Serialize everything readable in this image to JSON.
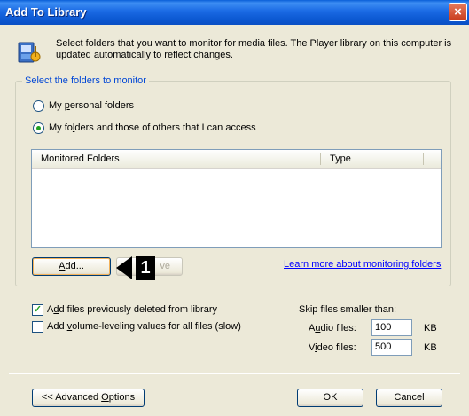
{
  "window": {
    "title": "Add To Library",
    "close_icon": "×"
  },
  "header": {
    "icon": "media-library-icon",
    "description": "Select folders that you want to monitor for media files. The Player library on this computer is updated automatically to reflect changes."
  },
  "group": {
    "label": "Select the folders to monitor",
    "options": [
      {
        "pre": "My ",
        "accel": "p",
        "post": "ersonal folders",
        "checked": false
      },
      {
        "pre": "My fo",
        "accel": "l",
        "post": "ders and those of others that I can access",
        "checked": true
      }
    ]
  },
  "list": {
    "columns": [
      "Monitored Folders",
      "Type"
    ],
    "rows": []
  },
  "buttons": {
    "add_accel": "A",
    "add_rest": "dd...",
    "remove_visible": "ve",
    "ok": "OK",
    "cancel": "Cancel",
    "advanced_pre": "<< Advanced ",
    "advanced_accel": "O",
    "advanced_post": "ptions"
  },
  "link": "Learn more about monitoring folders",
  "callout": "1",
  "checkboxes": [
    {
      "pre": "A",
      "accel": "d",
      "post": "d files previously deleted from library",
      "checked": true
    },
    {
      "pre": "Add ",
      "accel": "v",
      "post": "olume-leveling values for all files (slow)",
      "checked": false
    }
  ],
  "skip": {
    "label": "Skip files smaller than:",
    "audio_pre": "A",
    "audio_accel": "u",
    "audio_post": "dio files:",
    "audio_value": "100",
    "audio_unit": "KB",
    "video_pre": "V",
    "video_accel": "i",
    "video_post": "deo files:",
    "video_value": "500",
    "video_unit": "KB"
  },
  "colors": {
    "title_bar": "#0a5fd8",
    "group_label": "#0046d5",
    "link": "#0000ff",
    "dialog_bg": "#ece9d8"
  }
}
